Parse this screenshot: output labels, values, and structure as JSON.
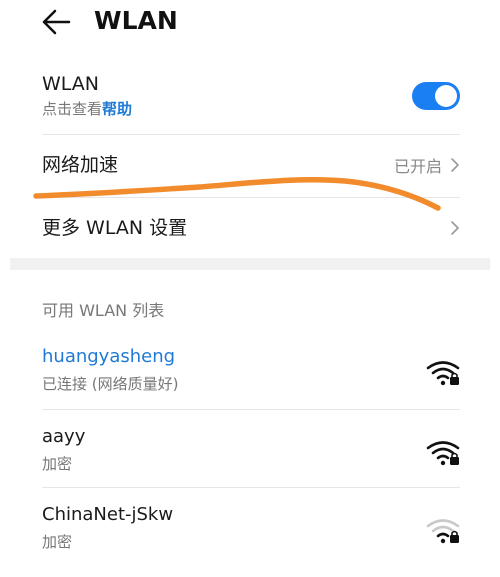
{
  "header": {
    "title": "WLAN",
    "back_icon": "back-arrow-icon"
  },
  "wlan": {
    "label": "WLAN",
    "subtitle_prefix": "点击查看",
    "help_link": "帮助",
    "enabled": true,
    "accent_color": "#1a7ff2"
  },
  "settings": [
    {
      "label": "网络加速",
      "value": "已开启"
    },
    {
      "label": "更多 WLAN 设置",
      "value": ""
    }
  ],
  "available": {
    "title": "可用 WLAN 列表",
    "networks": [
      {
        "name": "huangyasheng",
        "status": "已连接 (网络质量好)",
        "connected": true,
        "signal_icon": "wifi-lock-strong-icon"
      },
      {
        "name": "aayy",
        "status": "加密",
        "connected": false,
        "signal_icon": "wifi-lock-strong-icon"
      },
      {
        "name": "ChinaNet-jSkw",
        "status": "加密",
        "connected": false,
        "signal_icon": "wifi-lock-weak-icon"
      }
    ]
  },
  "colors": {
    "link_blue": "#1f7ad6",
    "annotation_orange": "#f28b2c"
  }
}
